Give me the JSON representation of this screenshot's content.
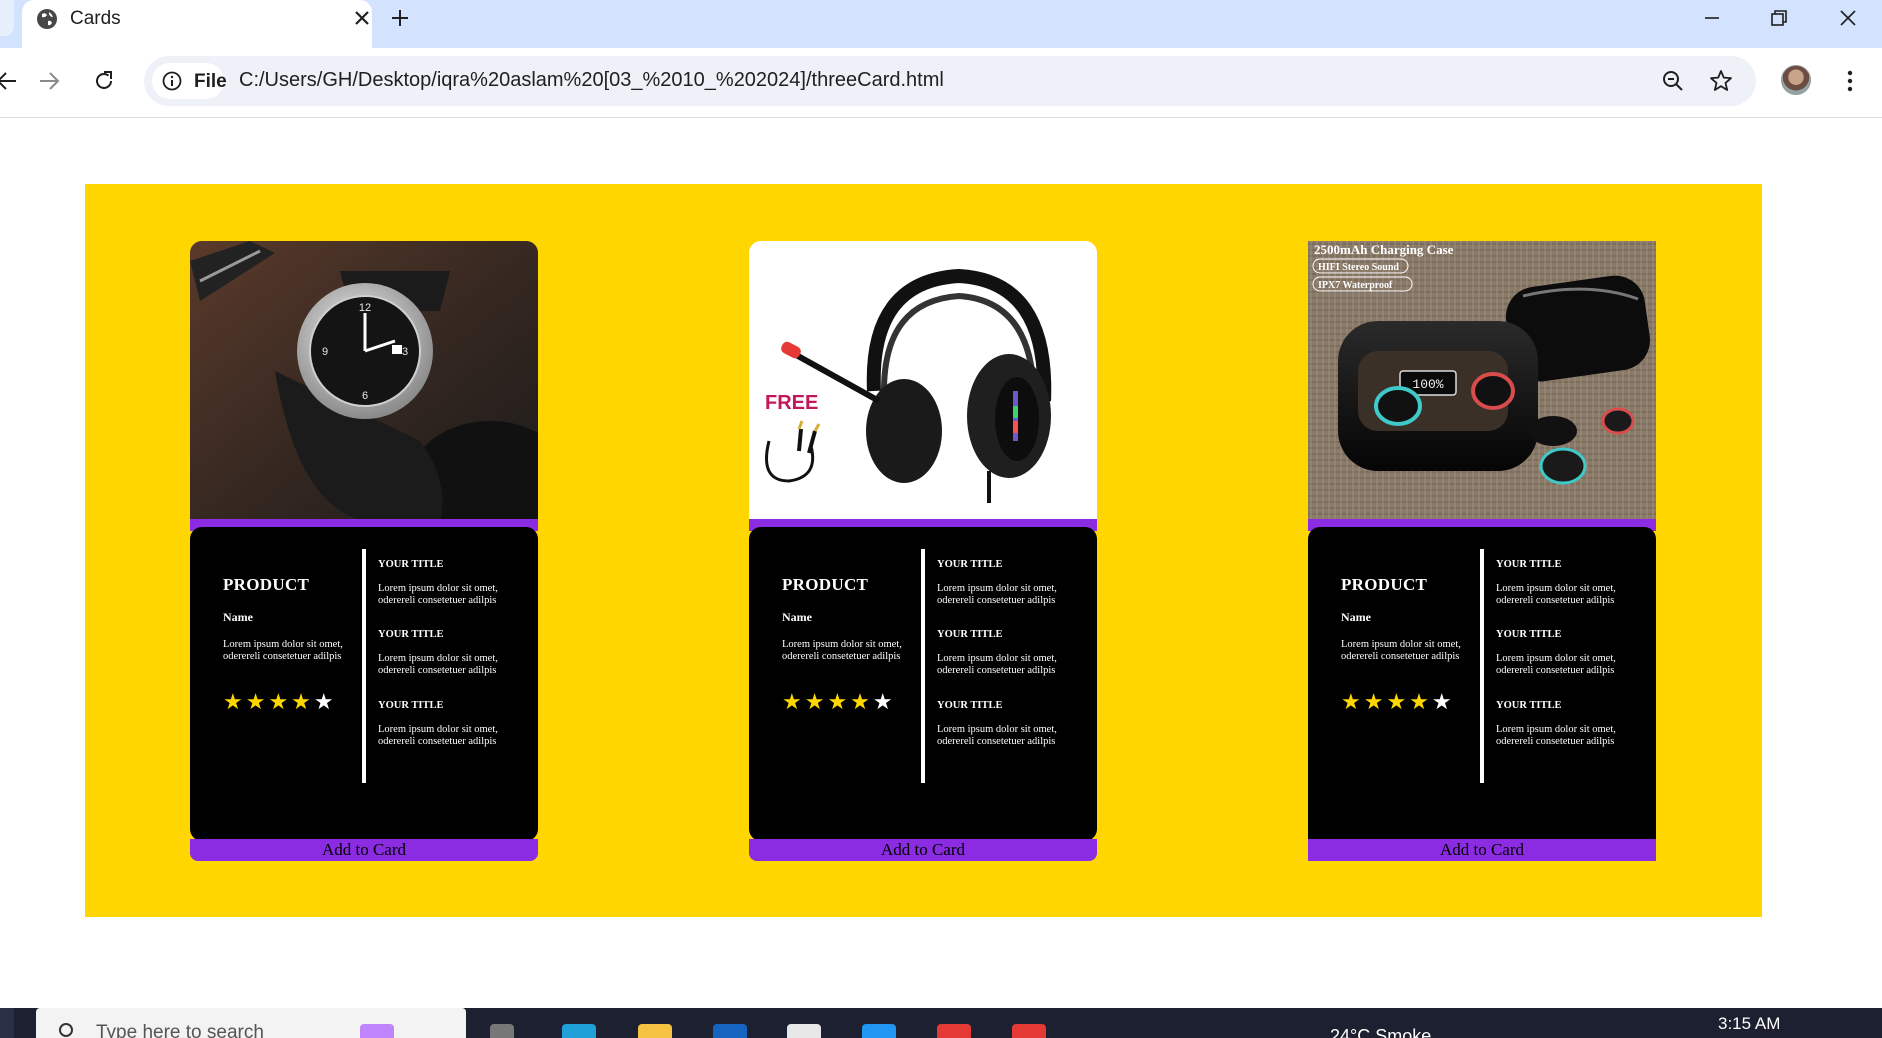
{
  "browser": {
    "tab_title": "Cards",
    "site_chip": "File",
    "url": "C:/Users/GH/Desktop/iqra%20aslam%20[03_%2010_%202024]/threeCard.html"
  },
  "colors": {
    "panel_background": "#ffd600",
    "card_background": "#000000",
    "accent_purple": "#8b2be2",
    "star_filled": "#ffd600",
    "star_empty": "#ffffff"
  },
  "cards": [
    {
      "image": "wristwatch-photo",
      "product": "PRODUCT",
      "name": "Name",
      "description": "Lorem ipsum dolor sit omet, oderereli consetetuer adilpis",
      "rating": 4,
      "max_rating": 5,
      "stars": "★★★★",
      "stars_empty": "★",
      "sections": [
        {
          "title": "YOUR TITLE",
          "text": "Lorem ipsum dolor sit omet, oderereli consetetuer adilpis"
        },
        {
          "title": "YOUR TITLE",
          "text": "Lorem ipsum dolor sit omet, oderereli consetetuer adilpis"
        },
        {
          "title": "YOUR TITLE",
          "text": "Lorem ipsum dolor sit omet, oderereli consetetuer adilpis"
        }
      ],
      "button": "Add to Card"
    },
    {
      "image": "gaming-headset-photo",
      "image_text": "FREE",
      "product": "PRODUCT",
      "name": "Name",
      "description": "Lorem ipsum dolor sit omet, oderereli consetetuer adilpis",
      "rating": 4,
      "max_rating": 5,
      "stars": "★★★★",
      "stars_empty": "★",
      "sections": [
        {
          "title": "YOUR TITLE",
          "text": "Lorem ipsum dolor sit omet, oderereli consetetuer adilpis"
        },
        {
          "title": "YOUR TITLE",
          "text": "Lorem ipsum dolor sit omet, oderereli consetetuer adilpis"
        },
        {
          "title": "YOUR TITLE",
          "text": "Lorem ipsum dolor sit omet, oderereli consetetuer adilpis"
        }
      ],
      "button": "Add to Card"
    },
    {
      "image": "wireless-earbuds-photo",
      "image_text": [
        "2500mAh Charging Case",
        "HIFI Stereo Sound",
        "IPX7 Waterproof"
      ],
      "product": "PRODUCT",
      "name": "Name",
      "description": "Lorem ipsum dolor sit omet, oderereli consetetuer adilpis",
      "rating": 4,
      "max_rating": 5,
      "stars": "★★★★",
      "stars_empty": "★",
      "sections": [
        {
          "title": "YOUR TITLE",
          "text": "Lorem ipsum dolor sit omet, oderereli consetetuer adilpis"
        },
        {
          "title": "YOUR TITLE",
          "text": "Lorem ipsum dolor sit omet, oderereli consetetuer adilpis"
        },
        {
          "title": "YOUR TITLE",
          "text": "Lorem ipsum dolor sit omet, oderereli consetetuer adilpis"
        }
      ],
      "button": "Add to Card"
    }
  ],
  "taskbar": {
    "search_placeholder": "Type here to search",
    "weather": "24°C  Smoke",
    "clock": "3:15 AM"
  }
}
